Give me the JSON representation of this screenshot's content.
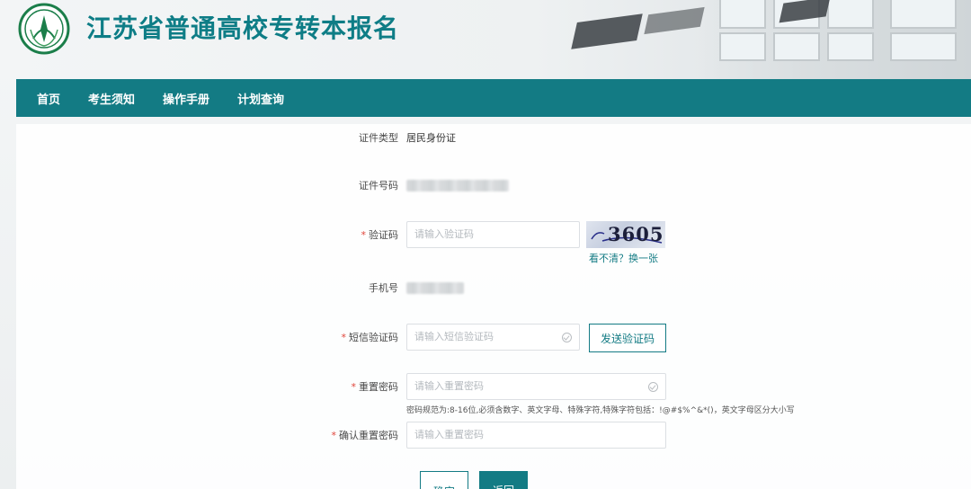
{
  "header": {
    "site_title": "江苏省普通高校专转本报名"
  },
  "nav": {
    "items": [
      {
        "label": "首页"
      },
      {
        "label": "考生须知"
      },
      {
        "label": "操作手册"
      },
      {
        "label": "计划查询"
      }
    ]
  },
  "form": {
    "id_type": {
      "label": "证件类型",
      "value": "居民身份证"
    },
    "id_number": {
      "label": "证件号码"
    },
    "captcha": {
      "label": "验证码",
      "placeholder": "请输入验证码",
      "image_text": "3605",
      "refresh_link": "看不清？换一张"
    },
    "phone": {
      "label": "手机号"
    },
    "sms_code": {
      "label": "短信验证码",
      "placeholder": "请输入短信验证码",
      "send_button": "发送验证码"
    },
    "new_password": {
      "label": "重置密码",
      "placeholder": "请输入重置密码",
      "hint": "密码规范为:8-16位,必须含数字、英文字母、特殊字符,特殊字符包括：!@#$%^&*()，英文字母区分大小写"
    },
    "confirm_password": {
      "label": "确认重置密码",
      "placeholder": "请输入重置密码"
    },
    "required_mark": "*",
    "confirm_button": "确定",
    "back_button": "返回"
  },
  "colors": {
    "brand": "#137b84",
    "required": "#e0443a"
  }
}
